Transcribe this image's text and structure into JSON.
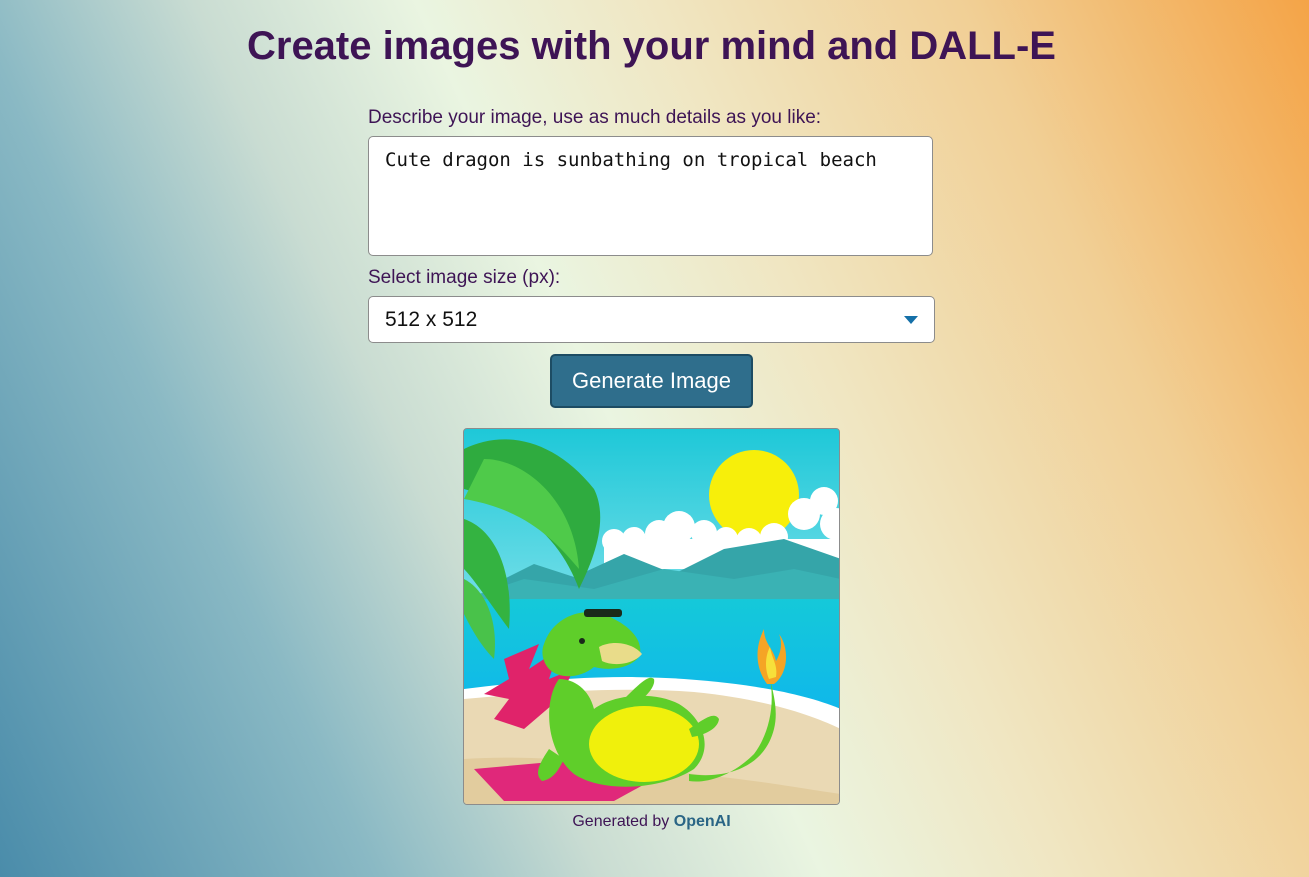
{
  "header": {
    "title": "Create images with your mind and DALL-E"
  },
  "form": {
    "prompt_label": "Describe your image, use as much details as you like:",
    "prompt_value": "Cute dragon is sunbathing on tropical beach",
    "size_label": "Select image size (px):",
    "size_selected": "512 x 512",
    "generate_label": "Generate Image"
  },
  "result": {
    "image_icon": "generated-dragon-beach-image",
    "credit_prefix": "Generated by",
    "credit_link": "OpenAI"
  },
  "colors": {
    "title": "#3e1455",
    "button": "#2f6e8c",
    "link": "#2a6585",
    "caret": "#1570a8"
  }
}
